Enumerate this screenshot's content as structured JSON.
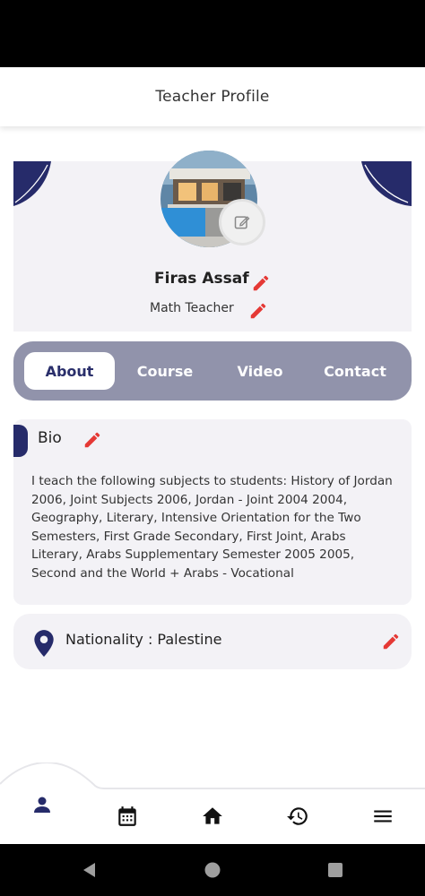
{
  "header": {
    "title": "Teacher Profile"
  },
  "profile": {
    "name": "Firas Assaf",
    "role": "Math Teacher"
  },
  "tabs": [
    {
      "label": "About",
      "active": true
    },
    {
      "label": "Course",
      "active": false
    },
    {
      "label": "Video",
      "active": false
    },
    {
      "label": "Contact",
      "active": false
    }
  ],
  "bio": {
    "title": "Bio",
    "text": "I teach the following subjects to students: History of Jordan 2006, Joint Subjects 2006, Jordan - Joint 2004 2004, Geography, Literary, Intensive Orientation for the Two Semesters, First Grade Secondary, First Joint, Arabs Literary, Arabs Supplementary Semester 2005 2005, Second and the World + Arabs - Vocational"
  },
  "nationality": {
    "text": "Nationality : Palestine"
  },
  "bottom_nav": [
    {
      "icon": "person-icon",
      "active": true
    },
    {
      "icon": "calendar-icon",
      "active": false
    },
    {
      "icon": "home-icon",
      "active": false
    },
    {
      "icon": "history-icon",
      "active": false
    },
    {
      "icon": "menu-icon",
      "active": false
    }
  ],
  "colors": {
    "primary": "#262b6a",
    "accent_edit": "#e53935",
    "tab_bar": "#9193ab",
    "card_bg": "#f3f2f6"
  }
}
